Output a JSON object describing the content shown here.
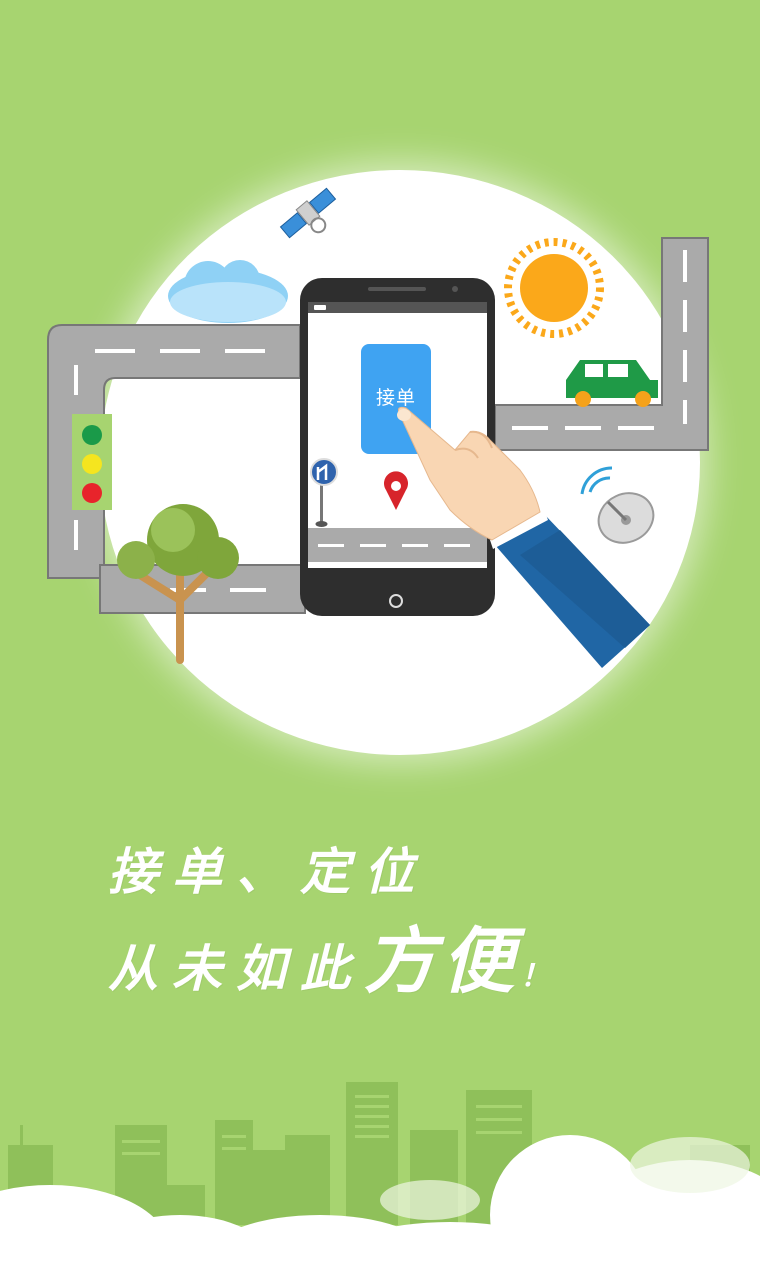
{
  "phone": {
    "accept_button_label": "接单"
  },
  "headline": {
    "line1": "接单、定位",
    "line2_main": "从未如此",
    "line2_emphasis": "方便",
    "line2_end": "！"
  },
  "colors": {
    "background": "#a7d470",
    "accept_button": "#3fa3f2",
    "road": "#aaaaaa",
    "car": "#1f9a47",
    "sun": "#fba81a",
    "location_pin": "#d7242b",
    "traffic_light_green": "#1a9a49",
    "traffic_light_yellow": "#f5e51f",
    "traffic_light_red": "#e8242b"
  },
  "icons": [
    "satellite-icon",
    "cloud-icon",
    "sun-icon",
    "car-icon",
    "traffic-light-icon",
    "tree-icon",
    "road-sign-icon",
    "location-pin-icon",
    "satellite-dish-icon",
    "pointing-hand-icon",
    "city-skyline"
  ]
}
